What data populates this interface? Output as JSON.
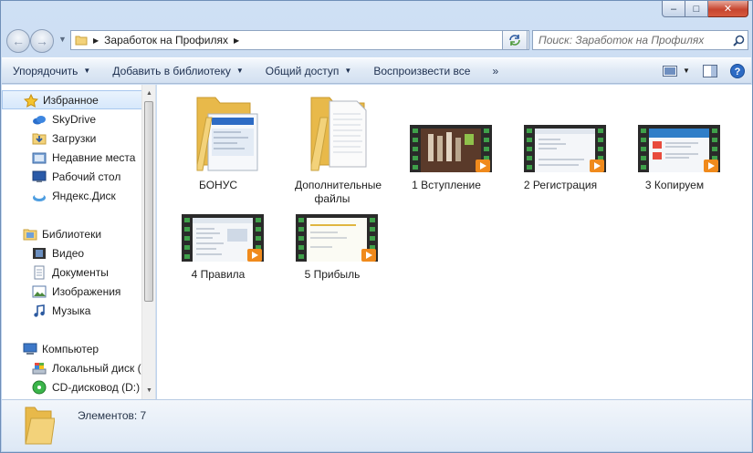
{
  "window": {
    "caption_min": "–",
    "caption_max": "□",
    "caption_close": "✕"
  },
  "address": {
    "crumb": "Заработок на Профилях"
  },
  "search": {
    "placeholder": "Поиск: Заработок на Профилях"
  },
  "toolbar": {
    "items": [
      "Упорядочить",
      "Добавить в библиотеку",
      "Общий доступ",
      "Воспроизвести все"
    ],
    "more": "»"
  },
  "nav": {
    "favorites_label": "Избранное",
    "favorites": [
      "SkyDrive",
      "Загрузки",
      "Недавние места",
      "Рабочий стол",
      "Яндекс.Диск"
    ],
    "libraries_label": "Библиотеки",
    "libraries": [
      "Видео",
      "Документы",
      "Изображения",
      "Музыка"
    ],
    "computer_label": "Компьютер",
    "computer": [
      "Локальный диск (",
      "CD-дисковод (D:)"
    ]
  },
  "files": [
    {
      "name": "БОНУС",
      "kind": "folder"
    },
    {
      "name": "Дополнительные файлы",
      "kind": "folder"
    },
    {
      "name": "1 Вступление",
      "kind": "video"
    },
    {
      "name": "2 Регистрация",
      "kind": "video"
    },
    {
      "name": "3 Копируем",
      "kind": "video"
    },
    {
      "name": "4 Правила",
      "kind": "video"
    },
    {
      "name": "5 Прибыль",
      "kind": "video"
    }
  ],
  "status": {
    "count": "Элементов: 7"
  },
  "colors": {
    "accent": "#2c5aa0",
    "play": "#f08a1c",
    "folder": "#f3d27a"
  }
}
